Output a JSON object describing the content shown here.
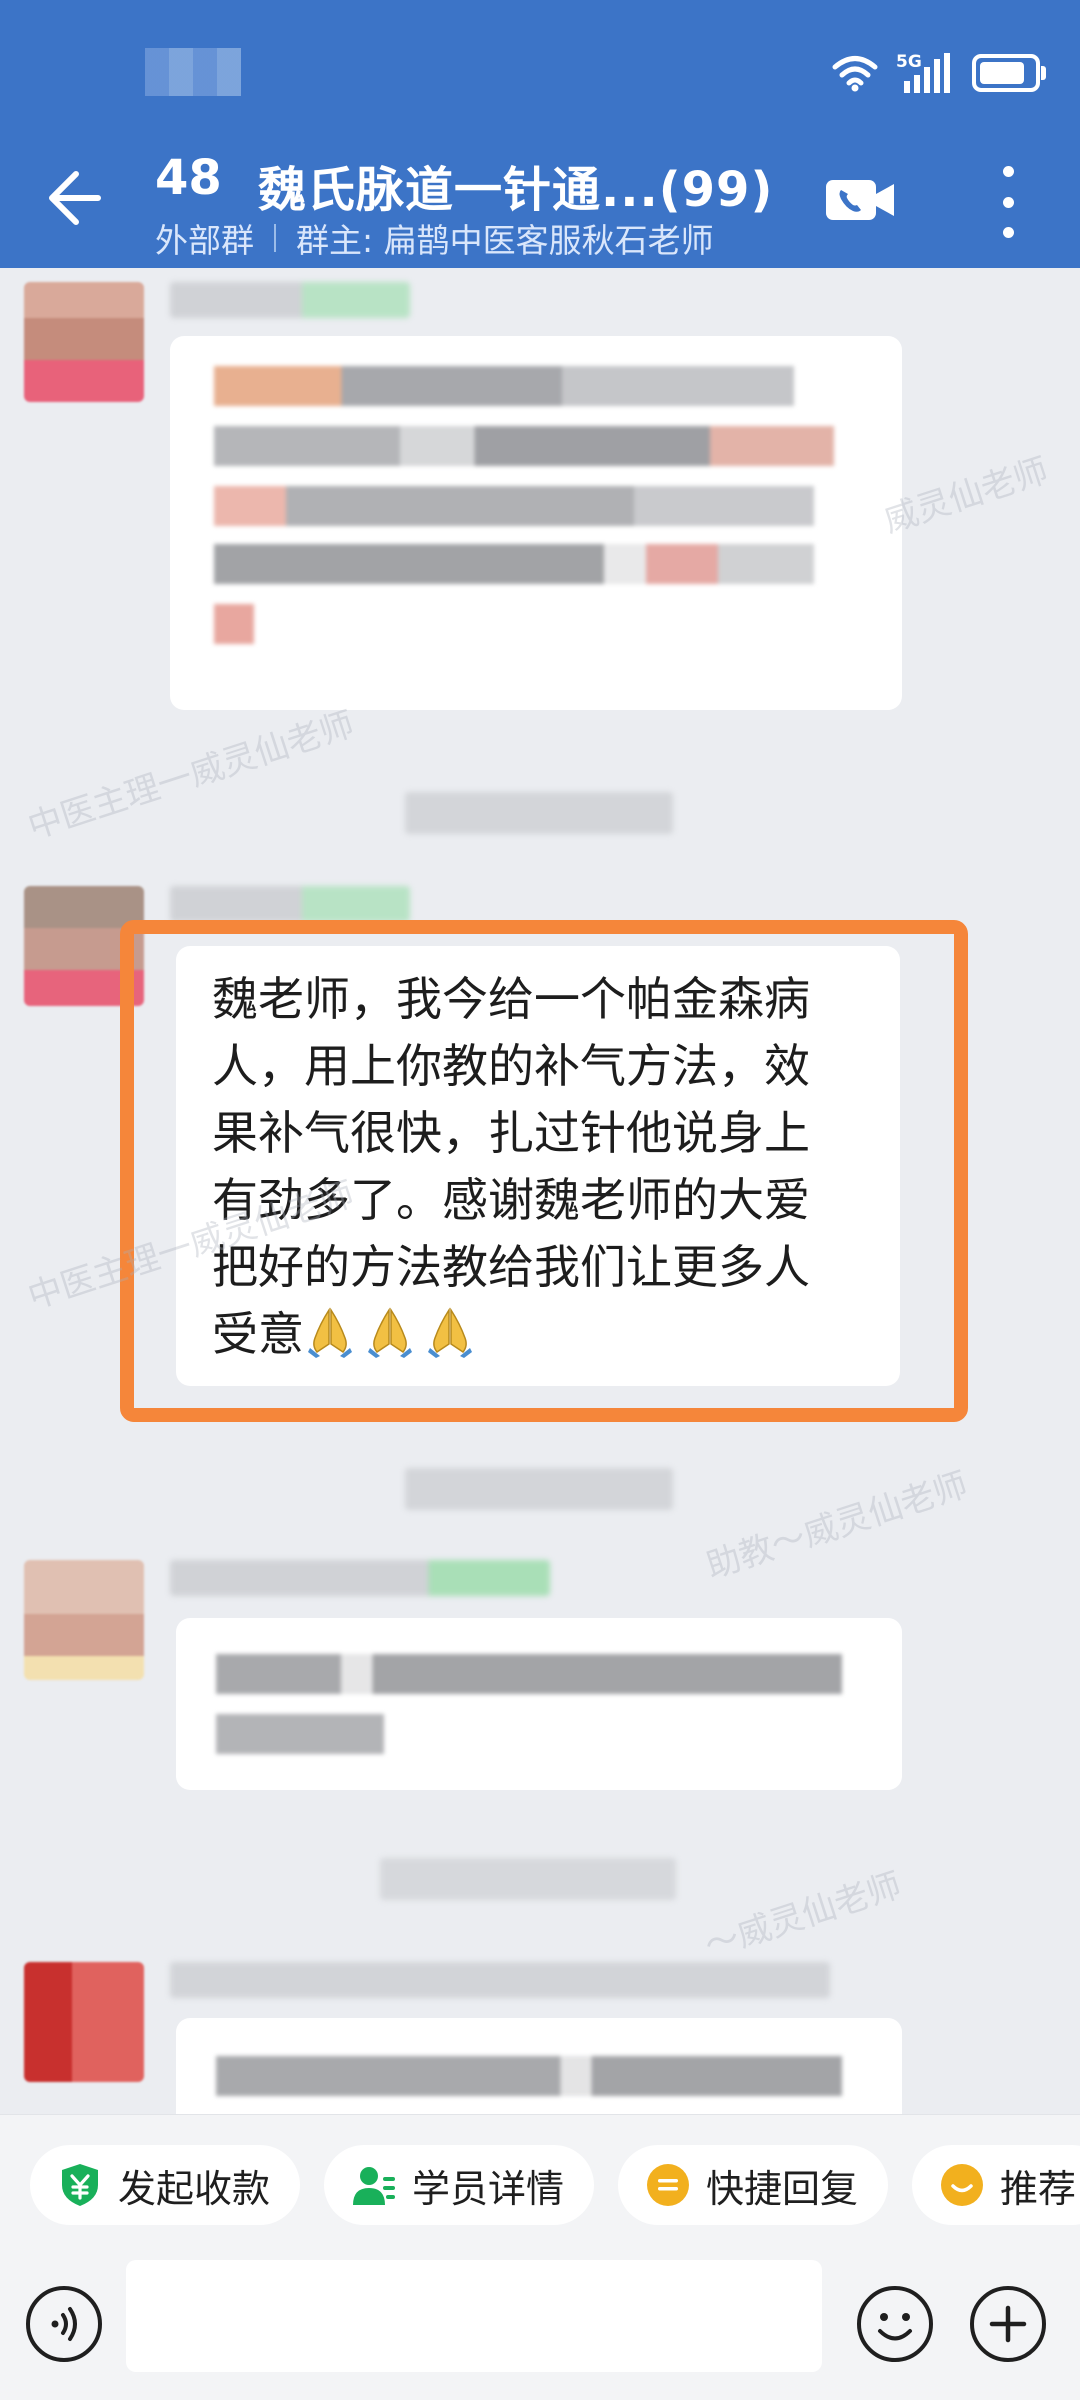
{
  "header": {
    "count": "48",
    "title": "魏氏脉道一针通...(99)",
    "group_type": "外部群",
    "group_owner": "群主: 扁鹊中医客服秋石老师",
    "bg_color": "#3c74c7"
  },
  "status_bar": {
    "network": "5G",
    "icons": [
      "wifi-icon",
      "signal-icon",
      "battery-icon"
    ]
  },
  "message": {
    "lines": [
      "魏老师，我今给一个帕金森病",
      "人，用上你教的补气方法，效",
      "果补气很快，扎过针他说身上",
      "有劲多了。感谢魏老师的大爱",
      "把好的方法教给我们让更多人",
      "受意"
    ],
    "emoji": "folded-hands-icon",
    "emoji_count": 3,
    "highlight_color": "#f5863a"
  },
  "watermarks": [
    "中医主理一威灵仙老师",
    "助教～威灵仙老师",
    "～威灵仙老师",
    "威灵仙老师"
  ],
  "quick_replies": [
    {
      "label": "发起收款",
      "icon": "payment-shield-icon",
      "color": "#19b05a"
    },
    {
      "label": "学员详情",
      "icon": "student-detail-icon",
      "color": "#19b05a"
    },
    {
      "label": "快捷回复",
      "icon": "quick-reply-icon",
      "color": "#f2b01e"
    },
    {
      "label": "推荐",
      "icon": "recommend-icon",
      "color": "#f2b01e"
    }
  ],
  "input": {
    "placeholder": "",
    "value": ""
  }
}
